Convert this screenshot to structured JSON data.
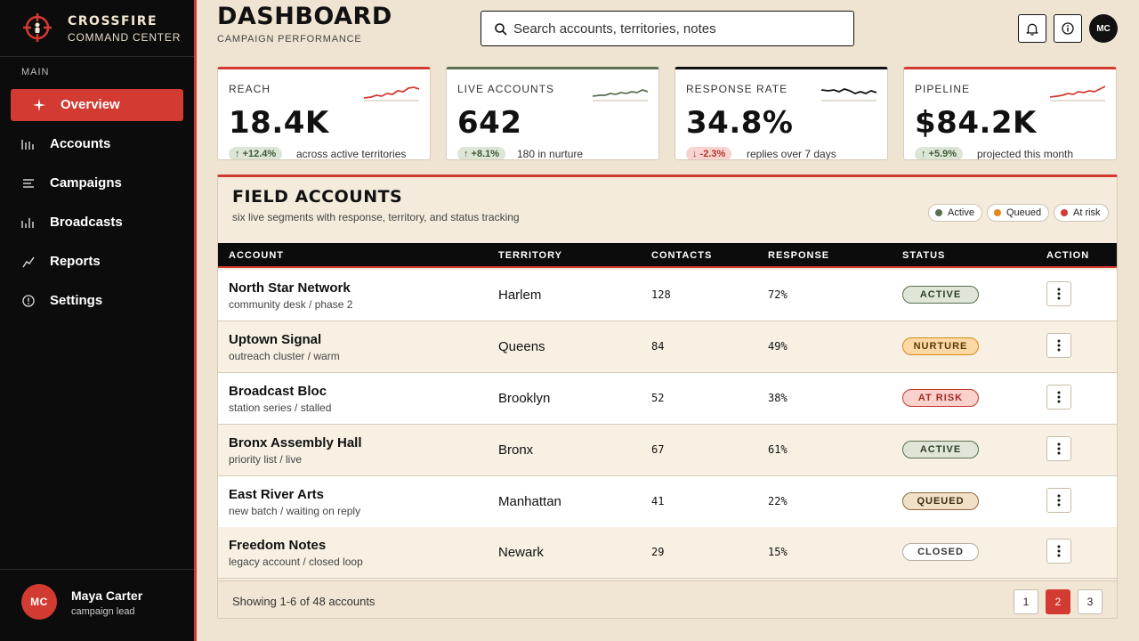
{
  "brand": {
    "name": "CROSSFIRE",
    "subtitle": "COMMAND CENTER"
  },
  "sidebar": {
    "section_label": "MAIN",
    "items": [
      {
        "label": "Overview",
        "icon": "sparkle-icon",
        "active": true
      },
      {
        "label": "Accounts",
        "icon": "bars-icon"
      },
      {
        "label": "Campaigns",
        "icon": "list-icon"
      },
      {
        "label": "Broadcasts",
        "icon": "signal-bars-icon"
      },
      {
        "label": "Reports",
        "icon": "trend-icon"
      },
      {
        "label": "Settings",
        "icon": "settings-icon"
      }
    ]
  },
  "user": {
    "initials": "MC",
    "name": "Maya Carter",
    "role": "campaign lead"
  },
  "header": {
    "title": "DASHBOARD",
    "subtitle": "CAMPAIGN PERFORMANCE",
    "search_placeholder": "Search accounts, territories, notes",
    "avatar_initials": "MC"
  },
  "kpis": [
    {
      "label": "REACH",
      "value": "18.4K",
      "delta": "↑ +12.4%",
      "direction": "up",
      "note": "across active territories",
      "accent": "#d33a32"
    },
    {
      "label": "LIVE ACCOUNTS",
      "value": "642",
      "delta": "↑ +8.1%",
      "direction": "up",
      "note": "180 in nurture",
      "accent": "#5b6f52"
    },
    {
      "label": "RESPONSE RATE",
      "value": "34.8%",
      "delta": "↓ -2.3%",
      "direction": "down",
      "note": "replies over 7 days",
      "accent": "#111111"
    },
    {
      "label": "PIPELINE",
      "value": "$84.2K",
      "delta": "↑ +5.9%",
      "direction": "up",
      "note": "projected this month",
      "accent": "#d33a32"
    }
  ],
  "table": {
    "title": "FIELD ACCOUNTS",
    "subtitle": "six live segments with response, territory, and status tracking",
    "legend": [
      {
        "label": "Active",
        "color": "#5b6f52"
      },
      {
        "label": "Queued",
        "color": "#e08a1a"
      },
      {
        "label": "At risk",
        "color": "#d33a32"
      }
    ],
    "columns": [
      "ACCOUNT",
      "TERRITORY",
      "CONTACTS",
      "RESPONSE",
      "STATUS",
      "ACTION"
    ],
    "rows": [
      {
        "name": "North Star Network",
        "meta": "community desk / phase 2",
        "territory": "Harlem",
        "contacts": "128",
        "response": "72%",
        "status": "ACTIVE",
        "status_type": "active"
      },
      {
        "name": "Uptown Signal",
        "meta": "outreach cluster / warm",
        "territory": "Queens",
        "contacts": "84",
        "response": "49%",
        "status": "NURTURE",
        "status_type": "nurture"
      },
      {
        "name": "Broadcast Bloc",
        "meta": "station series / stalled",
        "territory": "Brooklyn",
        "contacts": "52",
        "response": "38%",
        "status": "AT RISK",
        "status_type": "risk"
      },
      {
        "name": "Bronx Assembly Hall",
        "meta": "priority list / live",
        "territory": "Bronx",
        "contacts": "67",
        "response": "61%",
        "status": "ACTIVE",
        "status_type": "active"
      },
      {
        "name": "East River Arts",
        "meta": "new batch / waiting on reply",
        "territory": "Manhattan",
        "contacts": "41",
        "response": "22%",
        "status": "QUEUED",
        "status_type": "queued"
      },
      {
        "name": "Freedom Notes",
        "meta": "legacy account / closed loop",
        "territory": "Newark",
        "contacts": "29",
        "response": "15%",
        "status": "CLOSED",
        "status_type": "closed"
      }
    ],
    "footer_text": "Showing 1-6 of 48 accounts",
    "pages": [
      "1",
      "2",
      "3"
    ],
    "current_page": "2"
  }
}
